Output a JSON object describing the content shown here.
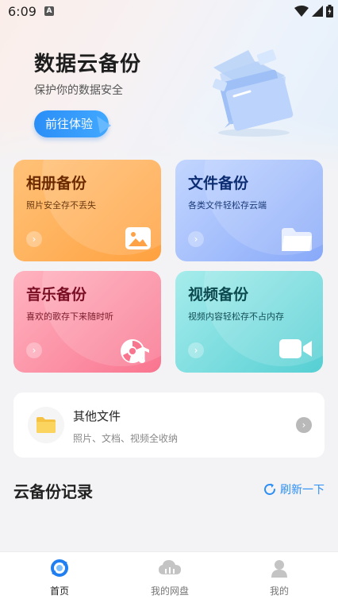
{
  "status_bar": {
    "time": "6:09",
    "notification_letter": "A"
  },
  "hero": {
    "title": "数据云备份",
    "subtitle": "保护你的数据安全",
    "button_label": "前往体验"
  },
  "cards": [
    {
      "title": "相册备份",
      "desc": "照片安全存不丢失",
      "icon": "image-icon",
      "title_color": "#6b2a00",
      "desc_color": "#6b3a10"
    },
    {
      "title": "文件备份",
      "desc": "各类文件轻松存云端",
      "icon": "folder-icon",
      "title_color": "#0d2d73",
      "desc_color": "#1a3a78"
    },
    {
      "title": "音乐备份",
      "desc": "喜欢的歌存下来随时听",
      "icon": "music-disc-icon",
      "title_color": "#7a0f24",
      "desc_color": "#7a1a2a"
    },
    {
      "title": "视频备份",
      "desc": "视频内容轻松存不占内存",
      "icon": "video-camera-icon",
      "title_color": "#0c4a4f",
      "desc_color": "#124e55"
    }
  ],
  "other_files": {
    "title": "其他文件",
    "desc": "照片、文档、视频全收纳"
  },
  "records": {
    "title": "云备份记录",
    "refresh_label": "刷新一下"
  },
  "tabs": [
    {
      "label": "首页",
      "icon": "home-sync-icon",
      "active": true
    },
    {
      "label": "我的网盘",
      "icon": "cloud-icon",
      "active": false
    },
    {
      "label": "我的",
      "icon": "user-icon",
      "active": false
    }
  ],
  "colors": {
    "accent": "#2b8ef5",
    "card_photo": "#ffa246",
    "card_file": "#8aaefc",
    "card_music": "#fa7a93",
    "card_video": "#5fd2d5"
  }
}
